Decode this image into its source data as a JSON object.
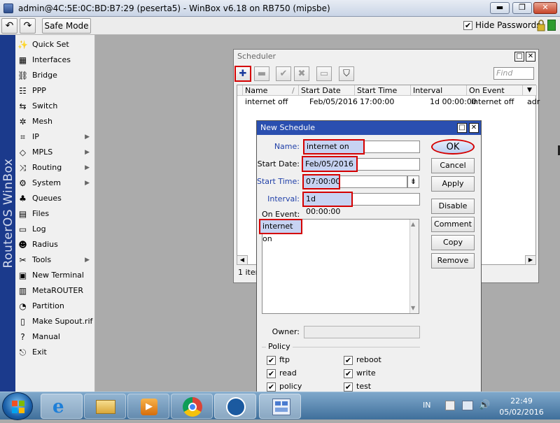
{
  "window": {
    "title": "admin@4C:5E:0C:BD:B7:29 (peserta5) - WinBox v6.18 on RB750 (mipsbe)",
    "minimize_glyph": "▬",
    "maximize_glyph": "❐",
    "close_glyph": "✕"
  },
  "toolbar": {
    "undo_glyph": "↶",
    "redo_glyph": "↷",
    "safe_mode_label": "Safe Mode",
    "hide_passwords_label": "Hide Passwords",
    "hide_passwords_checked": "✔",
    "lock_icon": "lock-icon"
  },
  "sidebar": {
    "brand_text": "RouterOS WinBox",
    "items": [
      {
        "label": "Quick Set",
        "icon": "✨",
        "arrow": ""
      },
      {
        "label": "Interfaces",
        "icon": "▦",
        "arrow": ""
      },
      {
        "label": "Bridge",
        "icon": "⛓",
        "arrow": ""
      },
      {
        "label": "PPP",
        "icon": "☷",
        "arrow": ""
      },
      {
        "label": "Switch",
        "icon": "⇆",
        "arrow": ""
      },
      {
        "label": "Mesh",
        "icon": "✲",
        "arrow": ""
      },
      {
        "label": "IP",
        "icon": "⌗",
        "arrow": "▶"
      },
      {
        "label": "MPLS",
        "icon": "◇",
        "arrow": "▶"
      },
      {
        "label": "Routing",
        "icon": "⤨",
        "arrow": "▶"
      },
      {
        "label": "System",
        "icon": "⚙",
        "arrow": "▶"
      },
      {
        "label": "Queues",
        "icon": "♣",
        "arrow": ""
      },
      {
        "label": "Files",
        "icon": "▤",
        "arrow": ""
      },
      {
        "label": "Log",
        "icon": "▭",
        "arrow": ""
      },
      {
        "label": "Radius",
        "icon": "☻",
        "arrow": ""
      },
      {
        "label": "Tools",
        "icon": "✂",
        "arrow": "▶"
      },
      {
        "label": "New Terminal",
        "icon": "▣",
        "arrow": ""
      },
      {
        "label": "MetaROUTER",
        "icon": "▥",
        "arrow": ""
      },
      {
        "label": "Partition",
        "icon": "◔",
        "arrow": ""
      },
      {
        "label": "Make Supout.rif",
        "icon": "▯",
        "arrow": ""
      },
      {
        "label": "Manual",
        "icon": "?",
        "arrow": ""
      },
      {
        "label": "Exit",
        "icon": "⎋",
        "arrow": ""
      }
    ]
  },
  "scheduler": {
    "title": "Scheduler",
    "find_placeholder": "Find",
    "buttons": {
      "add": "✚",
      "remove": "▬",
      "enable": "✔",
      "disable": "✖",
      "comment": "▭",
      "filter": "⛉"
    },
    "columns": [
      "Name",
      "Start Date",
      "Start Time",
      "Interval",
      "On Event"
    ],
    "row": {
      "name": "internet off",
      "start_date": "Feb/05/2016",
      "start_time": "17:00:00",
      "interval": "1d 00:00:00",
      "on_event": "internet off",
      "overflow": "adr"
    },
    "status": "1 item",
    "scroll_left": "◀",
    "scroll_right": "▶",
    "sort_glyph": "/",
    "menu_glyph": "▼"
  },
  "dialog": {
    "title": "New Schedule",
    "labels": {
      "name": "Name:",
      "start_date": "Start Date:",
      "start_time": "Start Time:",
      "interval": "Interval:",
      "on_event": "On Event:",
      "owner": "Owner:",
      "policy": "Policy"
    },
    "values": {
      "name": "internet on",
      "start_date": "Feb/05/2016",
      "start_time": "07:00:00",
      "interval": "1d 00:00:00",
      "on_event": "internet on",
      "owner": ""
    },
    "dropdown_glyph": "⇟",
    "scroll_up": "▲",
    "scroll_down": "▼",
    "buttons": [
      "OK",
      "Cancel",
      "Apply",
      "Disable",
      "Comment",
      "Copy",
      "Remove"
    ],
    "policies": [
      {
        "label": "ftp",
        "checked": "✔"
      },
      {
        "label": "reboot",
        "checked": "✔"
      },
      {
        "label": "read",
        "checked": "✔"
      },
      {
        "label": "write",
        "checked": "✔"
      },
      {
        "label": "policy",
        "checked": "✔"
      },
      {
        "label": "test",
        "checked": "✔"
      }
    ]
  },
  "taskbar": {
    "language": "IN",
    "time": "22:49",
    "date": "05/02/2016"
  },
  "colors": {
    "accent_blue": "#1b3a8c",
    "highlight_red": "#d40000",
    "selected_field": "#c7d3f2",
    "taskbar": "#4d7ba6"
  }
}
